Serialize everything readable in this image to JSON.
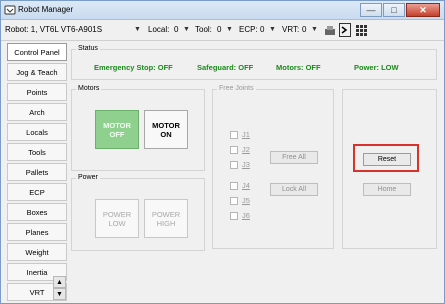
{
  "window": {
    "title": "Robot Manager",
    "controls": {
      "minimize": "—",
      "maximize": "□",
      "close": "✕"
    }
  },
  "toolbar": {
    "robot_label": "Robot: 1, VT6L VT6-A901S",
    "local_label": "Local:",
    "local_value": "0",
    "tool_label": "Tool:",
    "tool_value": "0",
    "ecp_label": "ECP:",
    "ecp_value": "0",
    "vrt_label": "VRT:",
    "vrt_value": "0"
  },
  "sidebar": {
    "items": [
      {
        "label": "Control Panel",
        "active": true
      },
      {
        "label": "Jog & Teach"
      },
      {
        "label": "Points"
      },
      {
        "label": "Arch"
      },
      {
        "label": "Locals"
      },
      {
        "label": "Tools"
      },
      {
        "label": "Pallets"
      },
      {
        "label": "ECP"
      },
      {
        "label": "Boxes"
      },
      {
        "label": "Planes"
      },
      {
        "label": "Weight"
      },
      {
        "label": "Inertia"
      },
      {
        "label": "VRT"
      }
    ]
  },
  "status": {
    "group_label": "Status",
    "emergency_stop": "Emergency Stop: OFF",
    "safeguard": "Safeguard: OFF",
    "motors": "Motors: OFF",
    "power": "Power: LOW"
  },
  "motors": {
    "group_label": "Motors",
    "motor_off_line1": "MOTOR",
    "motor_off_line2": "OFF",
    "motor_on_line1": "MOTOR",
    "motor_on_line2": "ON"
  },
  "power": {
    "group_label": "Power",
    "power_low_line1": "POWER",
    "power_low_line2": "LOW",
    "power_high_line1": "POWER",
    "power_high_line2": "HIGH"
  },
  "free_joints": {
    "group_label": "Free Joints",
    "joints": [
      "J1",
      "J2",
      "J3",
      "J4",
      "J5",
      "J6"
    ],
    "free_all": "Free All",
    "lock_all": "Lock All"
  },
  "actions": {
    "reset": "Reset",
    "home": "Home"
  },
  "colors": {
    "status_green": "#1a8a1a",
    "motor_off_active": "#8fd08f",
    "highlight": "#d9312b"
  }
}
